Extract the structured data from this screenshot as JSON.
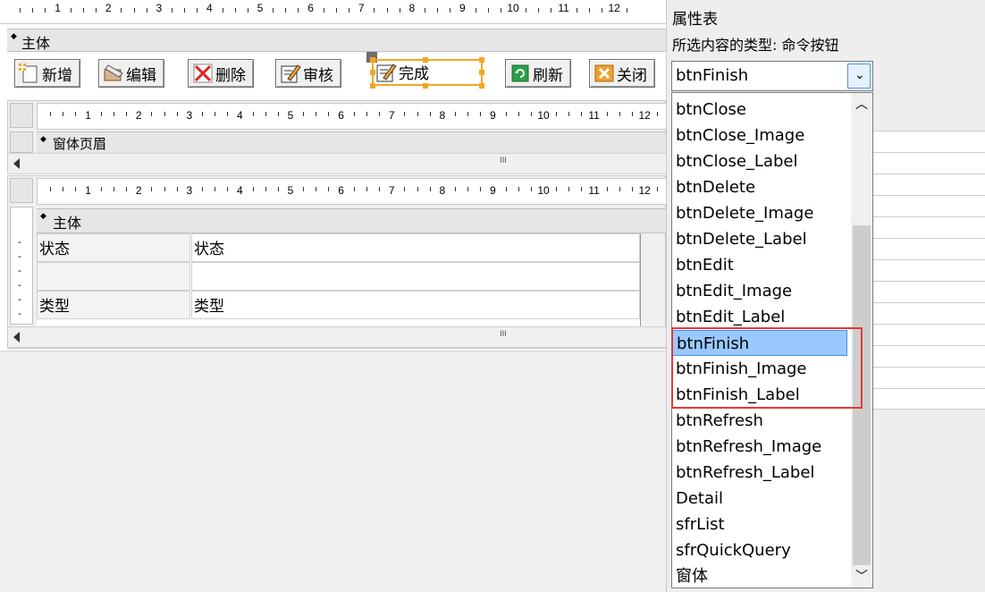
{
  "design_ruler_top": {
    "numbers": [
      "1",
      "2",
      "3",
      "4",
      "5",
      "6",
      "7",
      "8",
      "9",
      "10",
      "11",
      "12"
    ]
  },
  "main_section": {
    "label": "主体"
  },
  "toolbar": {
    "buttons": [
      {
        "label": "新增",
        "icon": "new-record-icon"
      },
      {
        "label": "编辑",
        "icon": "edit-icon"
      },
      {
        "label": "删除",
        "icon": "delete-icon"
      },
      {
        "label": "审核",
        "icon": "review-icon"
      },
      {
        "label": "完成",
        "icon": "finish-icon"
      },
      {
        "label": "刷新",
        "icon": "refresh-icon"
      },
      {
        "label": "关闭",
        "icon": "close-icon"
      }
    ]
  },
  "ruler2": {
    "numbers": [
      "1",
      "2",
      "3",
      "4",
      "5",
      "6",
      "7",
      "8",
      "9",
      "10",
      "11",
      "12"
    ]
  },
  "form_header_section": {
    "label": "窗体页眉"
  },
  "ruler3": {
    "numbers": [
      "1",
      "2",
      "3",
      "4",
      "5",
      "6",
      "7",
      "8",
      "9",
      "10",
      "11",
      "12"
    ]
  },
  "detail_section": {
    "label": "主体"
  },
  "detail_rows": [
    {
      "label": "状态",
      "value": "状态"
    },
    {
      "label": "",
      "value": ""
    },
    {
      "label": "类型",
      "value": "类型"
    }
  ],
  "scroll_thumb_glyph": "III",
  "property_sheet": {
    "title": "属性表",
    "selection_type": "所选内容的类型: 命令按钮",
    "selected_control": "btnFinish",
    "list_items": [
      "btnClose",
      "btnClose_Image",
      "btnClose_Label",
      "btnDelete",
      "btnDelete_Image",
      "btnDelete_Label",
      "btnEdit",
      "btnEdit_Image",
      "btnEdit_Label",
      "btnFinish",
      "btnFinish_Image",
      "btnFinish_Label",
      "btnRefresh",
      "btnRefresh_Image",
      "btnRefresh_Label",
      "Detail",
      "sfrList",
      "sfrQuickQuery",
      "窗体"
    ],
    "selected_index": 9,
    "highlight_color": "#e53935"
  }
}
